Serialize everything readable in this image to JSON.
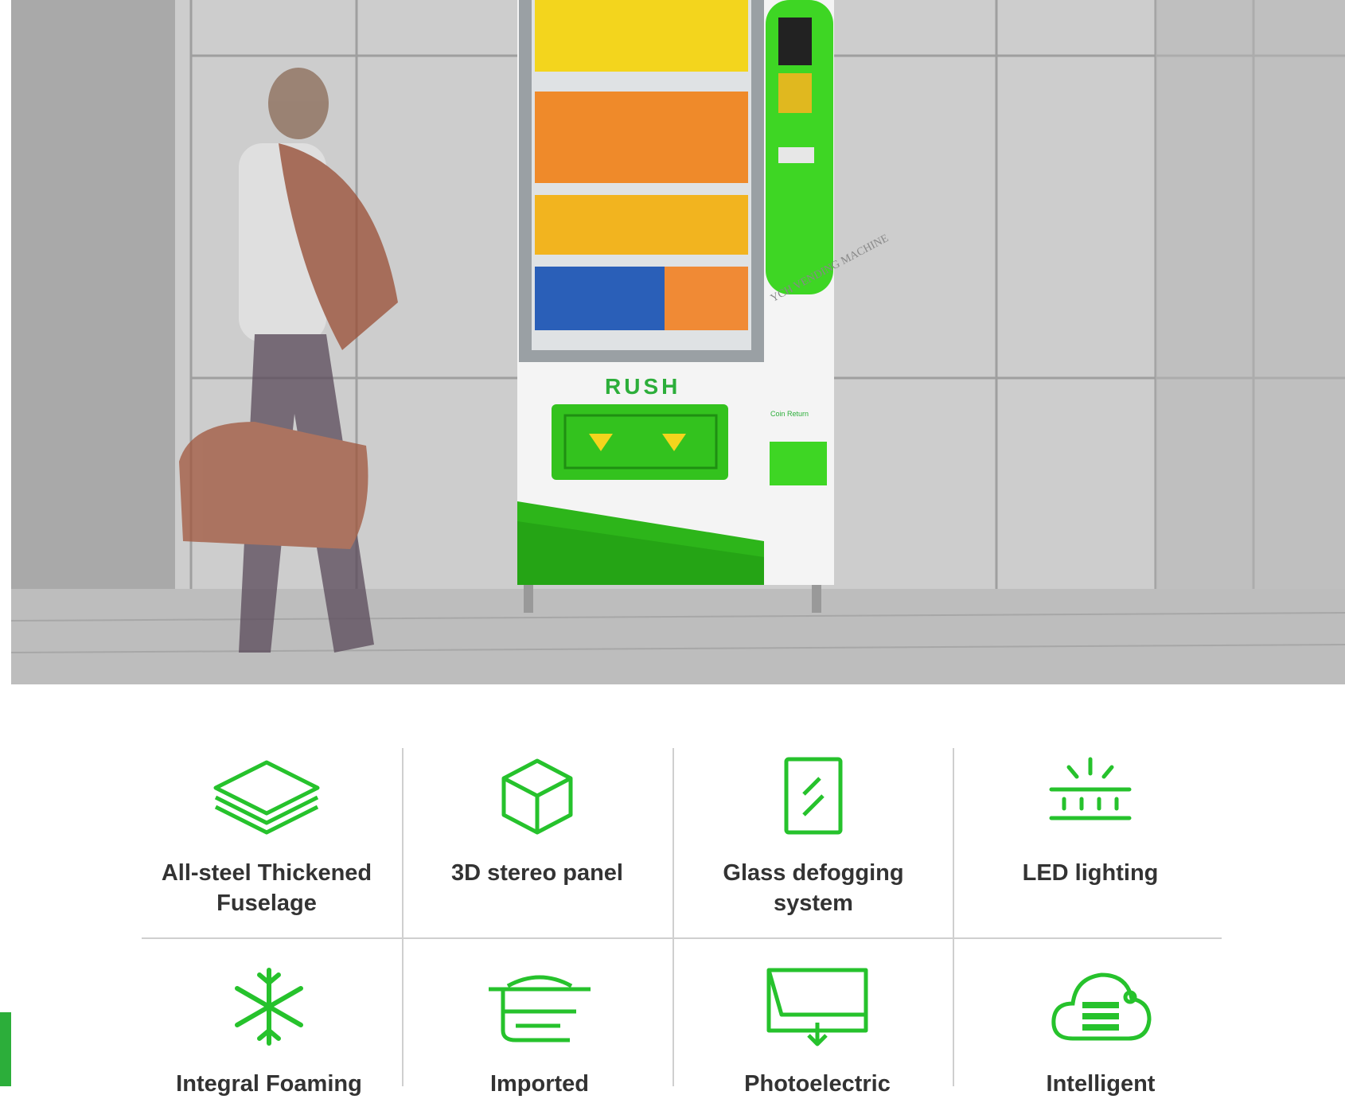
{
  "hero": {
    "machine_slogan": "RUSH",
    "coin_return_label": "Coin Return",
    "watermark": "YCH VENDING MACHINE"
  },
  "colors": {
    "accent": "#26c22c",
    "panel_green": "#3ed624",
    "text": "#333333"
  },
  "features": [
    {
      "label": "All-steel Thickened Fuselage",
      "icon": "stacked-layers-icon"
    },
    {
      "label": "3D stereo panel",
      "icon": "cube-icon"
    },
    {
      "label": "Glass defogging system",
      "icon": "glass-panel-icon"
    },
    {
      "label": "LED lighting",
      "icon": "led-light-icon"
    },
    {
      "label": "Integral Foaming",
      "icon": "snowflake-icon"
    },
    {
      "label": "Imported",
      "icon": "compressor-icon"
    },
    {
      "label": "Photoelectric",
      "icon": "photoelectric-icon"
    },
    {
      "label": "Intelligent",
      "icon": "cloud-server-icon"
    }
  ]
}
